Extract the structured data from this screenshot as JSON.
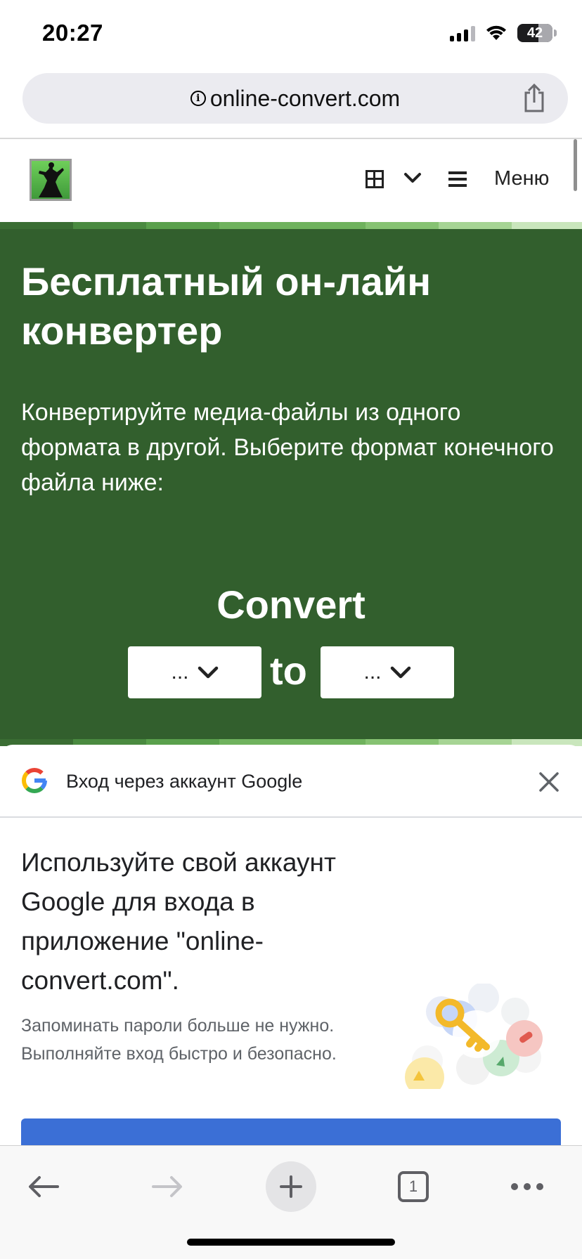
{
  "status_bar": {
    "time": "20:27",
    "battery": "42",
    "icons": [
      "cellular-signal-icon",
      "wifi-icon",
      "battery-icon"
    ]
  },
  "browser": {
    "url": "online-convert.com",
    "info_icon": "info-icon",
    "share_icon": "share-icon"
  },
  "site_header": {
    "logo": "logo-icon",
    "grid_icon": "grid-icon",
    "dropdown_icon": "chevron-down-icon",
    "menu_icon": "hamburger-icon",
    "menu_label": "Меню"
  },
  "hero": {
    "title": "Бесплатный он-лайн конвертер",
    "subtitle": "Конвертируйте медиа-файлы из одного формата в другой. Выберите формат конечного файла ниже:",
    "convert_label": "Convert",
    "from_select": "...",
    "to_label": "to",
    "to_select": "...",
    "colors": {
      "background": "#325f2d",
      "stripe": [
        "#3a6d33",
        "#4a8a40",
        "#5aa04c",
        "#6fb25d",
        "#86c272",
        "#a6d494",
        "#c9e6bc"
      ]
    }
  },
  "google_sheet": {
    "header": "Вход через аккаунт Google",
    "title": "Используйте свой аккаунт Google для входа в приложение \"online-convert.com\".",
    "description": "Запоминать пароли больше не нужно. Выполняйте вход быстро и безопасно.",
    "close_icon": "close-icon",
    "illustration": "key-icon",
    "button_color": "#3b6fd6"
  },
  "toolbar": {
    "back_icon": "back-arrow-icon",
    "forward_icon": "forward-arrow-icon",
    "new_tab_icon": "plus-icon",
    "tab_count": "1",
    "more_icon": "more-icon"
  }
}
